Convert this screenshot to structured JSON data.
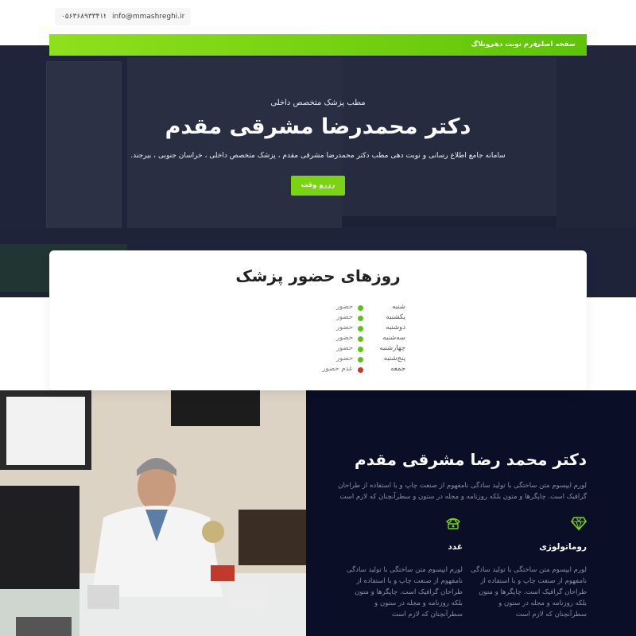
{
  "contact": {
    "phone": "۰۵۶۳۶۸۹۳۳۴۱۲",
    "email": "info@mmashreghi.ir"
  },
  "nav": {
    "items": [
      "صفحه اصلی",
      "فرم نوبت دهی",
      "وبلاگ"
    ]
  },
  "hero": {
    "subtitle": "مطب پزشک متخصص داخلی",
    "title": "دکتر محمدرضا مشرقی مقدم",
    "description": "سامانه جامع اطلاع رسانی و نوبت دهی مطب دکتر محمدرضا مشرقی مقدم ، پزشک متخصص داخلی ، خراسان جنوبی ، بیرجند.",
    "button_label": "رزرو وقت"
  },
  "attendance": {
    "title": "روزهای حضور پزشک",
    "days": [
      {
        "day": "شنبه",
        "status": "حضور",
        "present": true
      },
      {
        "day": "یکشنبه",
        "status": "حضور",
        "present": true
      },
      {
        "day": "دوشنبه",
        "status": "حضور",
        "present": true
      },
      {
        "day": "سه‌شنبه",
        "status": "حضور",
        "present": true
      },
      {
        "day": "چهارشنبه",
        "status": "حضور",
        "present": true
      },
      {
        "day": "پنج‌شنبه",
        "status": "حضور",
        "present": true
      },
      {
        "day": "جمعه",
        "status": "عدم حضور",
        "present": false
      }
    ],
    "present_color": "#5cc218",
    "absent_color": "#c0392b"
  },
  "doctor": {
    "name": "دکتر محمد رضا مشرقی مقدم",
    "description": "لورم ایپسوم متن ساختگی با تولید سادگی نامفهوم از صنعت چاپ و با استفاده از طراحان گرافیک است. چاپگرها و متون بلکه روزنامه و مجله در ستون و سطرآنچنان که لازم است",
    "features": [
      {
        "title": "روماتولوژی",
        "icon": "diamond-icon",
        "text": "لورم ایپسوم متن ساختگی با تولید سادگی نامفهوم از صنعت چاپ و با استفاده از طراحان گرافیک است. چاپگرها و متون بلکه روزنامه و مجله در ستون و سطرآنچنان که لازم است"
      },
      {
        "title": "غدد",
        "icon": "telephone-icon",
        "text": "لورم ایپسوم متن ساختگی با تولید سادگی نامفهوم از صنعت چاپ و با استفاده از طراحان گرافیک است. چاپگرها و متون بلکه روزنامه و مجله در ستون و سطرآنچنان که لازم است"
      }
    ]
  },
  "colors": {
    "accent": "#7ad414",
    "dark_bg": "#0a0e26",
    "hero_bg": "#262c44"
  }
}
